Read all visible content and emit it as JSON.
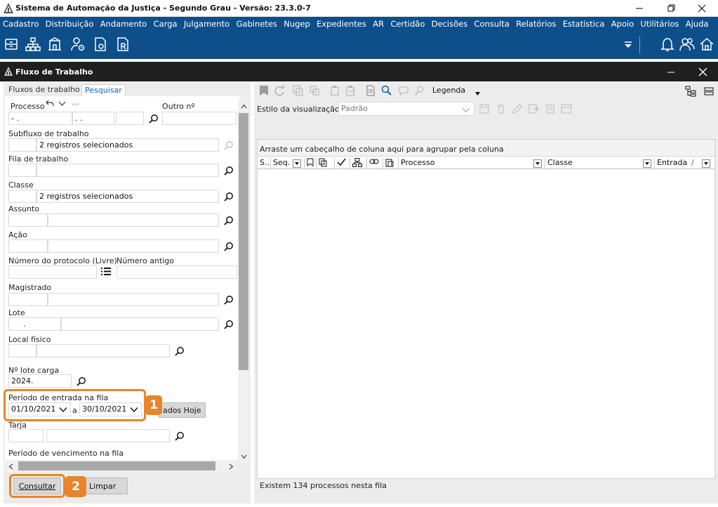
{
  "window": {
    "title": "Sistema de Automação da Justiça - Segundo Grau - Versão: 23.3.0-7"
  },
  "menu": [
    "Cadastro",
    "Distribuição",
    "Andamento",
    "Carga",
    "Julgamento",
    "Gabinetes",
    "Nugep",
    "Expedientes",
    "AR",
    "Certidão",
    "Decisões",
    "Consulta",
    "Relatórios",
    "Estatística",
    "Apoio",
    "Utilitários",
    "Ajuda"
  ],
  "subwindow": {
    "title": "Fluxo de Trabalho"
  },
  "left": {
    "tabs": {
      "fluxos": "Fluxos de trabalho",
      "pesquisar": "Pesquisar"
    },
    "processo_label": "Processo",
    "processo_mask1": "-  .",
    "processo_mask2": ".  .",
    "more": "···",
    "outro_label": "Outro nº",
    "subfluxo_label": "Subfluxo de trabalho",
    "subfluxo_value": "2 registros selecionados",
    "fila_label": "Fila de trabalho",
    "classe_label": "Classe",
    "classe_value": "2 registros selecionados",
    "assunto_label": "Assunto",
    "acao_label": "Ação",
    "protocolo_label": "Número do protocolo (Livre)",
    "antigo_label": "Número antigo",
    "magistrado_label": "Magistrado",
    "lote_label": "Lote",
    "lote_mask": ".",
    "local_label": "Local físico",
    "lote_carga_label": "Nº lote carga",
    "lote_carga_value": "2024.",
    "periodo_label": "Período de entrada na fila",
    "date_from": "01/10/2021",
    "date_sep": "a",
    "date_to": "30/10/2021",
    "hoje_btn": "ados Hoje",
    "tarja_label": "Tarja",
    "vencimento_label": "Período de vencimento na fila",
    "consultar_btn": "Consultar",
    "limpar_btn": "Limpar",
    "callout1": "1",
    "callout2": "2"
  },
  "right": {
    "legenda": "Legenda",
    "estilo_label": "Estilo da visualização",
    "estilo_value": "Padrão",
    "group_hint": "Arraste um cabeçalho de coluna aqui para agrupar pela coluna",
    "columns": {
      "s": "S...",
      "seq": "Seq.",
      "processo": "Processo",
      "classe": "Classe",
      "entrada": "Entrada",
      "sort": "/"
    },
    "status": "Existem 134 processos nesta fila"
  },
  "colors": {
    "menu_bg": "#0d4f8b",
    "subheader_bg": "#1f1f1f",
    "accent": "#e8852a",
    "tab_active": "#0a64b4"
  }
}
